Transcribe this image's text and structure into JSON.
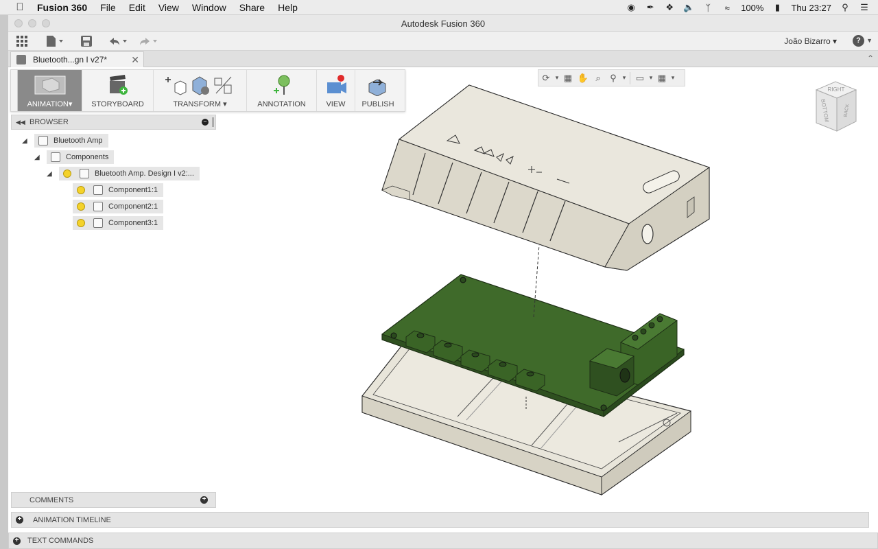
{
  "menubar": {
    "app_name": "Fusion 360",
    "items": [
      "File",
      "Edit",
      "View",
      "Window",
      "Share",
      "Help"
    ],
    "battery": "100%",
    "clock": "Thu 23:27"
  },
  "window": {
    "title": "Autodesk Fusion 360",
    "user": "João Bizarro",
    "help_glyph": "?"
  },
  "tab": {
    "label": "Bluetooth...gn I v27*"
  },
  "toolbar": {
    "workspace_label": "ANIMATION",
    "storyboard_label": "STORYBOARD",
    "transform_label": "TRANSFORM",
    "annotation_label": "ANNOTATION",
    "view_label": "VIEW",
    "publish_label": "PUBLISH"
  },
  "browser": {
    "title": "BROWSER",
    "root": "Bluetooth Amp",
    "components_folder": "Components",
    "design": "Bluetooth Amp. Design I v2:...",
    "components": [
      "Component1:1",
      "Component2:1",
      "Component3:1"
    ]
  },
  "panels": {
    "comments": "COMMENTS",
    "animation_timeline": "ANIMATION TIMELINE",
    "text_commands": "TEXT COMMANDS"
  },
  "viewcube": {
    "faces": [
      "RIGHT",
      "BOTTOM",
      "BACK"
    ]
  },
  "colors": {
    "pcb_green": "#3f6a2a",
    "enclosure": "#e6e3d8",
    "active_workspace": "#8a8a8a"
  }
}
